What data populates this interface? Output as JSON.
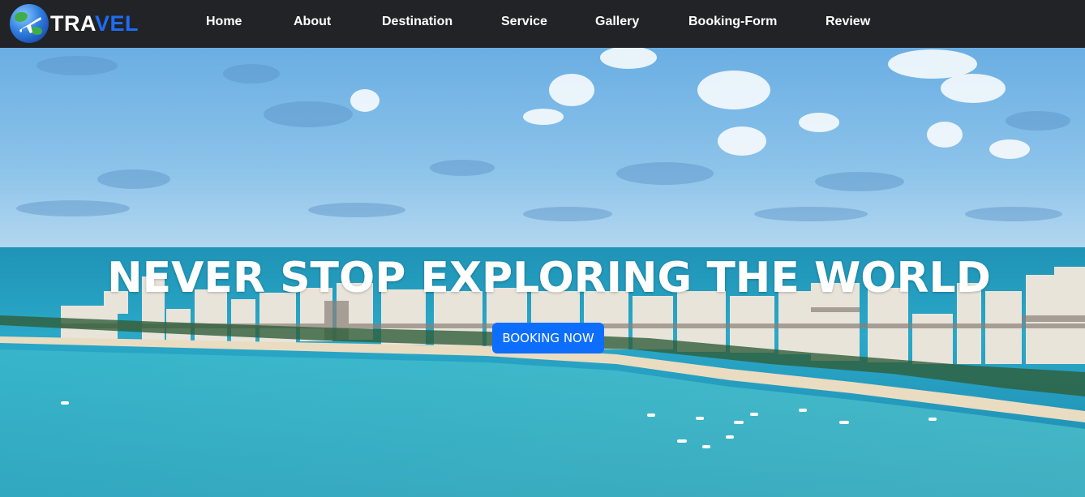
{
  "brand": {
    "text_white": "TRA",
    "text_blue": "VEL",
    "icon": "globe-airplane-icon",
    "accent_color": "#1e6cf5"
  },
  "nav": {
    "items": [
      {
        "label": "Home"
      },
      {
        "label": "About"
      },
      {
        "label": "Destination"
      },
      {
        "label": "Service"
      },
      {
        "label": "Gallery"
      },
      {
        "label": "Booking-Form"
      },
      {
        "label": "Review"
      }
    ]
  },
  "hero": {
    "title": "NEVER STOP EXPLORING THE WORLD",
    "button_label": "BOOKING NOW",
    "button_color": "#0d6efd"
  },
  "colors": {
    "navbar_bg": "#212327",
    "sky": "#6fb3e6",
    "sea": "#2aa7c9"
  }
}
